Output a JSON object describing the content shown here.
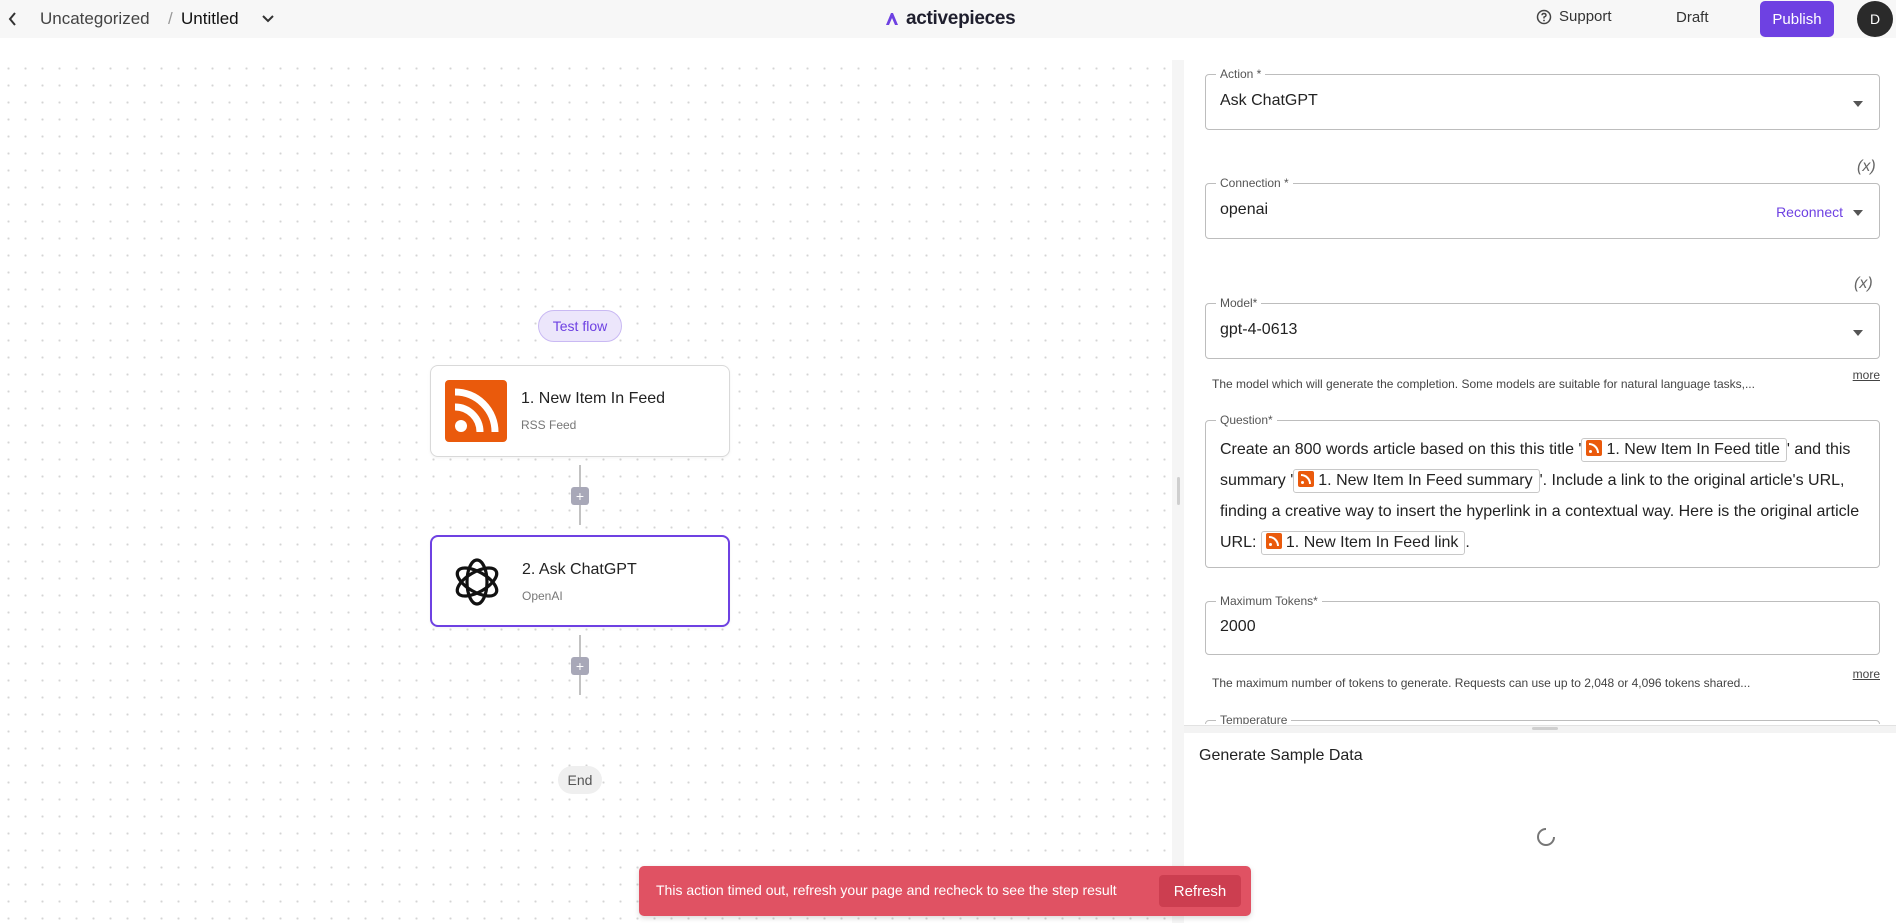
{
  "header": {
    "folder": "Uncategorized",
    "separator": "/",
    "flow_name": "Untitled",
    "brand": "activepieces",
    "support_label": "Support",
    "status_label": "Draft",
    "publish_label": "Publish",
    "avatar_initial": "D",
    "brand_color": "#6e41e2"
  },
  "canvas": {
    "test_flow_label": "Test flow",
    "steps": [
      {
        "title": "1. New Item In Feed",
        "subtitle": "RSS Feed",
        "icon": "rss-icon"
      },
      {
        "title": "2. Ask ChatGPT",
        "subtitle": "OpenAI",
        "icon": "openai-icon"
      }
    ],
    "add_label": "+",
    "end_label": "End"
  },
  "panel": {
    "action": {
      "label": "Action *",
      "value": "Ask ChatGPT"
    },
    "connection": {
      "label": "Connection *",
      "value": "openai",
      "reconnect_label": "Reconnect",
      "fx": "(x)"
    },
    "model": {
      "label": "Model*",
      "value": "gpt-4-0613",
      "fx": "(x)",
      "hint": "The model which will generate the completion. Some models are suitable for natural language tasks,...",
      "more": "more"
    },
    "question": {
      "label": "Question*",
      "part1": "Create an 800 words article based on this this title '",
      "token1": "1. New Item In Feed title",
      "part2": "' and this summary '",
      "token2": "1. New Item In Feed summary",
      "part3": "'. Include a link to the original article's URL, finding a creative way to insert the hyperlink in a contextual way. Here is the original article URL: ",
      "token3": "1. New Item In Feed link",
      "part4": "."
    },
    "max_tokens": {
      "label": "Maximum Tokens*",
      "value": "2000",
      "hint": "The maximum number of tokens to generate. Requests can use up to 2,048 or 4,096 tokens shared...",
      "more": "more"
    },
    "temperature": {
      "label": "Temperature"
    },
    "sample_title": "Generate Sample Data"
  },
  "toast": {
    "message": "This action timed out, refresh your page and recheck to see the step result",
    "button": "Refresh",
    "color": "#e05263"
  }
}
